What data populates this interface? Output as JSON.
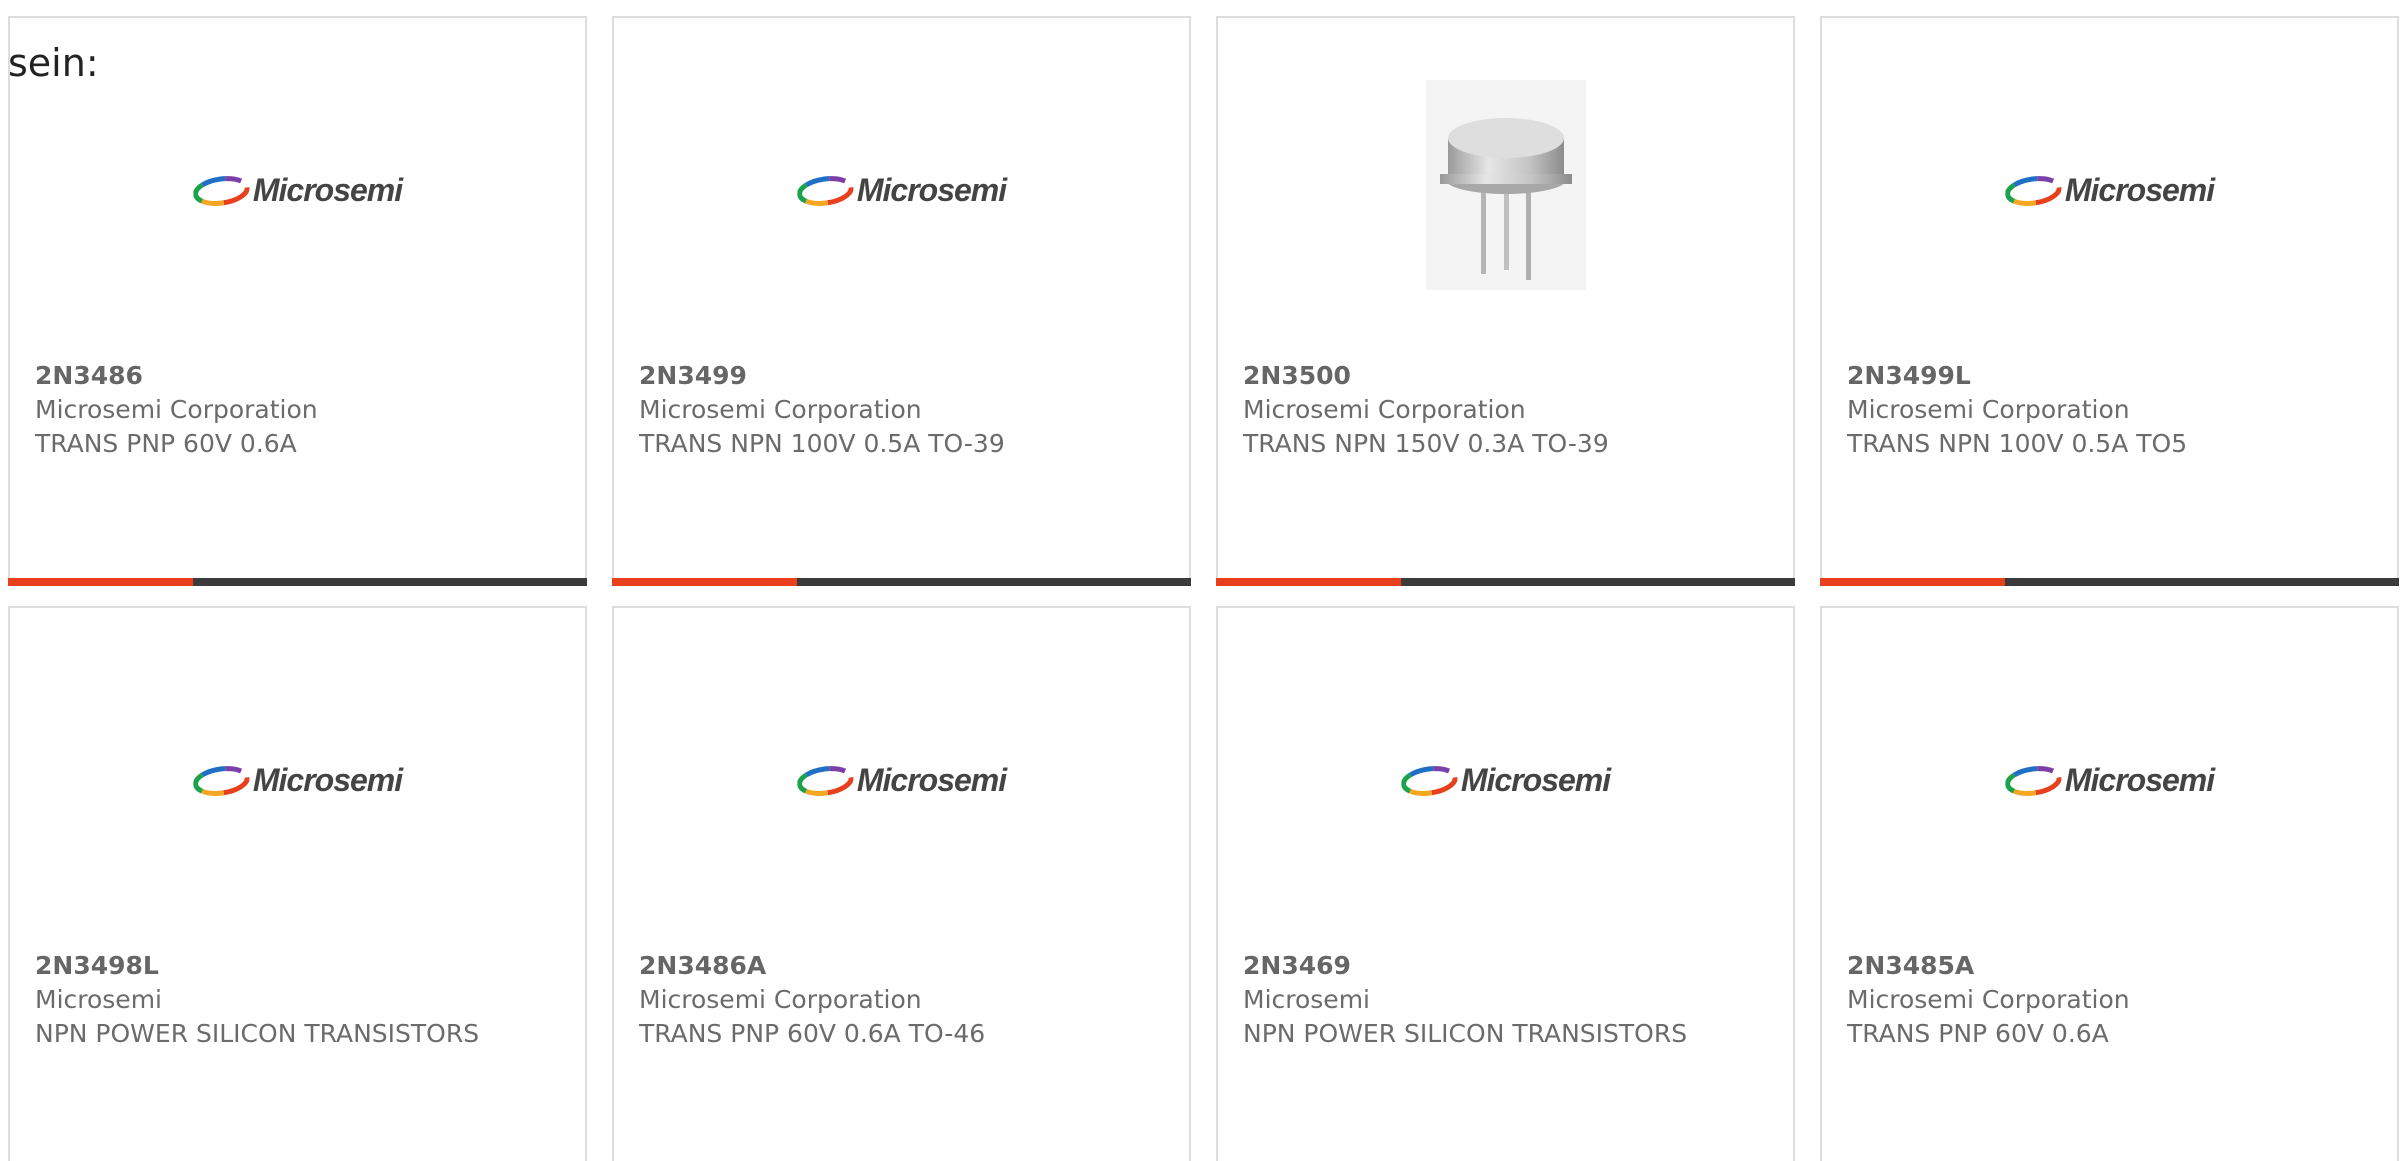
{
  "intro_text": "sein:",
  "colors": {
    "accent": "#e8401c",
    "bar": "#3b3b3b",
    "card_border": "#dddddd",
    "text": "#6b6b6b"
  },
  "cards": [
    {
      "part": "2N3486",
      "manufacturer": "Microsemi Corporation",
      "description": "TRANS PNP 60V 0.6A",
      "image": "microsemi-logo",
      "logo_text": "Microsemi",
      "accent_fraction": 0.32
    },
    {
      "part": "2N3499",
      "manufacturer": "Microsemi Corporation",
      "description": "TRANS NPN 100V 0.5A TO-39",
      "image": "microsemi-logo",
      "logo_text": "Microsemi",
      "accent_fraction": 0.32
    },
    {
      "part": "2N3500",
      "manufacturer": "Microsemi Corporation",
      "description": "TRANS NPN 150V 0.3A TO-39",
      "image": "to-39-transistor-photo",
      "accent_fraction": 0.32
    },
    {
      "part": "2N3499L",
      "manufacturer": "Microsemi Corporation",
      "description": "TRANS NPN 100V 0.5A TO5",
      "image": "microsemi-logo",
      "logo_text": "Microsemi",
      "accent_fraction": 0.32
    },
    {
      "part": "2N3498L",
      "manufacturer": "Microsemi",
      "description": "NPN POWER SILICON TRANSISTORS",
      "image": "microsemi-logo",
      "logo_text": "Microsemi"
    },
    {
      "part": "2N3486A",
      "manufacturer": "Microsemi Corporation",
      "description": "TRANS PNP 60V 0.6A TO-46",
      "image": "microsemi-logo",
      "logo_text": "Microsemi"
    },
    {
      "part": "2N3469",
      "manufacturer": "Microsemi",
      "description": "NPN POWER SILICON TRANSISTORS",
      "image": "microsemi-logo",
      "logo_text": "Microsemi"
    },
    {
      "part": "2N3485A",
      "manufacturer": "Microsemi Corporation",
      "description": "TRANS PNP 60V 0.6A",
      "image": "microsemi-logo",
      "logo_text": "Microsemi"
    }
  ]
}
